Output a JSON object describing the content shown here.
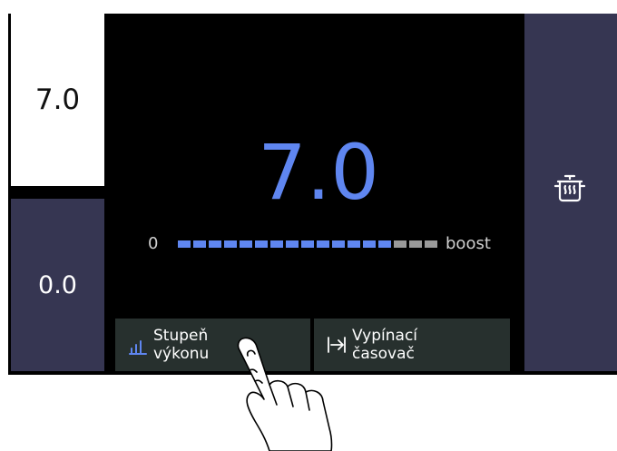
{
  "zones": {
    "active_value": "7.0",
    "idle_value": "0.0"
  },
  "main": {
    "power_value": "7.0",
    "scale_min": "0",
    "scale_max": "boost",
    "level_segments_total": 17,
    "level_segments_filled": 14
  },
  "buttons": {
    "power_level_label": "Stupeň\nvýkonu",
    "timer_label": "Vypínací\nčasovač"
  },
  "icons": {
    "right_panel": "pot-steam-icon",
    "power_button": "bar-chart-icon",
    "timer_button": "arrow-to-bar-icon"
  },
  "colors": {
    "accent": "#5f86f0",
    "panel_dark": "#363652",
    "button_bg": "#27302e",
    "segment_empty": "#9a9a9a"
  }
}
